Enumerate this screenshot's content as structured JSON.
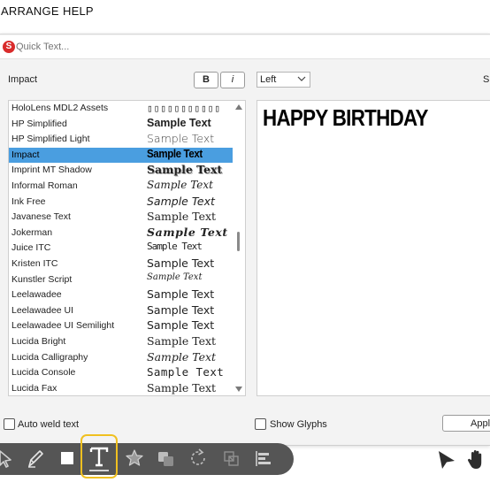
{
  "menubar": {
    "items": [
      {
        "label": "ARRANGE"
      },
      {
        "label": "HELP"
      }
    ]
  },
  "quick_text": {
    "icon": "S",
    "placeholder": "Quick Text..."
  },
  "font_panel": {
    "font_name": "Impact",
    "bold_label": "B",
    "italic_label": "i",
    "alignment": "Left",
    "size_label_partial": "Si"
  },
  "font_list": [
    {
      "name": "HoloLens MDL2 Assets",
      "sample": "▯▯▯▯▯▯▯▯▯▯▯"
    },
    {
      "name": "HP Simplified",
      "sample": "Sample Text"
    },
    {
      "name": "HP Simplified Light",
      "sample": "Sample Text"
    },
    {
      "name": "Impact",
      "sample": "Sample Text",
      "selected": true
    },
    {
      "name": "Imprint MT Shadow",
      "sample": "Sample Text"
    },
    {
      "name": "Informal Roman",
      "sample": "Sample Text"
    },
    {
      "name": "Ink Free",
      "sample": "Sample Text"
    },
    {
      "name": "Javanese Text",
      "sample": "Sample Text"
    },
    {
      "name": "Jokerman",
      "sample": "Sample Text"
    },
    {
      "name": "Juice ITC",
      "sample": "Sample Text"
    },
    {
      "name": "Kristen ITC",
      "sample": "Sample Text"
    },
    {
      "name": "Kunstler Script",
      "sample": "Sample Text"
    },
    {
      "name": "Leelawadee",
      "sample": "Sample Text"
    },
    {
      "name": "Leelawadee UI",
      "sample": "Sample Text"
    },
    {
      "name": "Leelawadee UI Semilight",
      "sample": "Sample Text"
    },
    {
      "name": "Lucida Bright",
      "sample": "Sample Text"
    },
    {
      "name": "Lucida Calligraphy",
      "sample": "Sample Text"
    },
    {
      "name": "Lucida Console",
      "sample": "Sample Text"
    },
    {
      "name": "Lucida Fax",
      "sample": "Sample Text"
    }
  ],
  "preview": {
    "text": "HAPPY BIRTHDAY"
  },
  "options": {
    "auto_weld": {
      "label": "Auto weld text",
      "checked": false
    },
    "show_glyphs": {
      "label": "Show Glyphs",
      "checked": false
    },
    "apply_label": "Appl"
  },
  "colors": {
    "selection": "#4a9ee0",
    "toolbar": "#555555",
    "highlight": "#f0c020",
    "quick_text_icon": "#d92b2b"
  },
  "toolbar": {
    "tools": [
      "select-arrow-icon",
      "pen-icon",
      "rectangle-icon",
      "text-tool-icon",
      "star-shape-icon",
      "weld-shapes-icon",
      "rotate-icon",
      "crop-icon",
      "align-icon"
    ],
    "active_tool": "text-tool-icon"
  },
  "canvas_tools": [
    "pointer-icon",
    "hand-pan-icon"
  ]
}
